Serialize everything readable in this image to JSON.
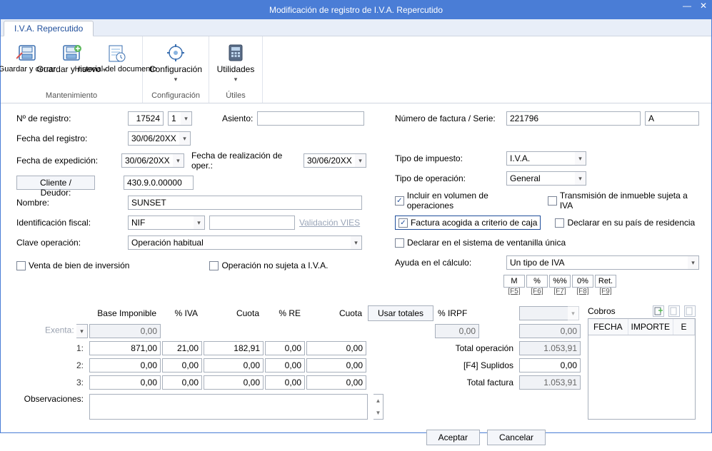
{
  "title": "Modificación de registro de I.V.A. Repercutido",
  "tab": "I.V.A. Repercutido",
  "ribbon": {
    "save_close": "Guardar y cerrar",
    "save_new": "Guardar y nuevo",
    "history": "Historial del documento",
    "group1": "Mantenimiento",
    "config": "Configuración",
    "group2": "Configuración",
    "utils": "Utilidades",
    "group3": "Útiles"
  },
  "left": {
    "nregistro_lbl": "Nº de registro:",
    "nregistro": "17524",
    "nreg2": "1",
    "asiento_lbl": "Asiento:",
    "asiento": "",
    "fecha_reg_lbl": "Fecha del registro:",
    "fecha_reg": "30/06/20XX",
    "fecha_exp_lbl": "Fecha de expedición:",
    "fecha_exp": "30/06/20XX",
    "fecha_oper_lbl": "Fecha de realización de oper.:",
    "fecha_oper": "30/06/20XX",
    "cliente_btn": "Cliente / Deudor:",
    "cliente": "430.9.0.00000",
    "nombre_lbl": "Nombre:",
    "nombre": "SUNSET",
    "idfiscal_lbl": "Identificación fiscal:",
    "idfiscal_tipo": "NIF",
    "idfiscal_num": "",
    "vies": "Validación VIES",
    "clave_lbl": "Clave operación:",
    "clave": "Operación habitual",
    "venta_bien": "Venta de bien de inversión",
    "no_sujeta": "Operación no sujeta a I.V.A."
  },
  "right": {
    "numfac_lbl": "Número de factura / Serie:",
    "numfac": "221796",
    "serie": "A",
    "tipo_imp_lbl": "Tipo de impuesto:",
    "tipo_imp": "I.V.A.",
    "tipo_op_lbl": "Tipo de operación:",
    "tipo_op": "General",
    "incluir_vol": "Incluir en volumen de operaciones",
    "transm": "Transmisión de inmueble sujeta a IVA",
    "fact_caja": "Factura acogida a criterio de caja",
    "decl_pais": "Declarar en su país de residencia",
    "decl_vent": "Declarar en el sistema de ventanilla única",
    "ayuda_lbl": "Ayuda en el cálculo:",
    "ayuda": "Un tipo de IVA",
    "calc": [
      "M",
      "%",
      "%%",
      "0%",
      "Ret."
    ],
    "calc_keys": [
      "[F5]",
      "[F6]",
      "[F7]",
      "[F8]",
      "[F9]"
    ]
  },
  "grid": {
    "h_base": "Base Imponible",
    "h_piva": "% IVA",
    "h_cuota": "Cuota",
    "h_pre": "% RE",
    "h_cuota2": "Cuota",
    "usar_totales": "Usar totales",
    "h_pirpf": "% IRPF",
    "exenta_lbl": "Exenta:",
    "r1_lbl": "1:",
    "r2_lbl": "2:",
    "r3_lbl": "3:",
    "exenta": {
      "base": "0,00",
      "irpf_base": "0,00",
      "irpf_amt": "0,00"
    },
    "r1": {
      "base": "871,00",
      "piva": "21,00",
      "cuota": "182,91",
      "pre": "0,00",
      "cuota2": "0,00"
    },
    "r2": {
      "base": "0,00",
      "piva": "0,00",
      "cuota": "0,00",
      "pre": "0,00",
      "cuota2": "0,00"
    },
    "r3": {
      "base": "0,00",
      "piva": "0,00",
      "cuota": "0,00",
      "pre": "0,00",
      "cuota2": "0,00"
    },
    "total_op_lbl": "Total operación",
    "total_op": "1.053,91",
    "suplidos_lbl": "[F4] Suplidos",
    "suplidos": "0,00",
    "total_fac_lbl": "Total factura",
    "total_fac": "1.053,91",
    "observ_lbl": "Observaciones:",
    "observ": ""
  },
  "cobros": {
    "title": "Cobros",
    "h_fecha": "FECHA",
    "h_importe": "IMPORTE",
    "h_e": "E"
  },
  "buttons": {
    "aceptar": "Aceptar",
    "cancelar": "Cancelar"
  }
}
